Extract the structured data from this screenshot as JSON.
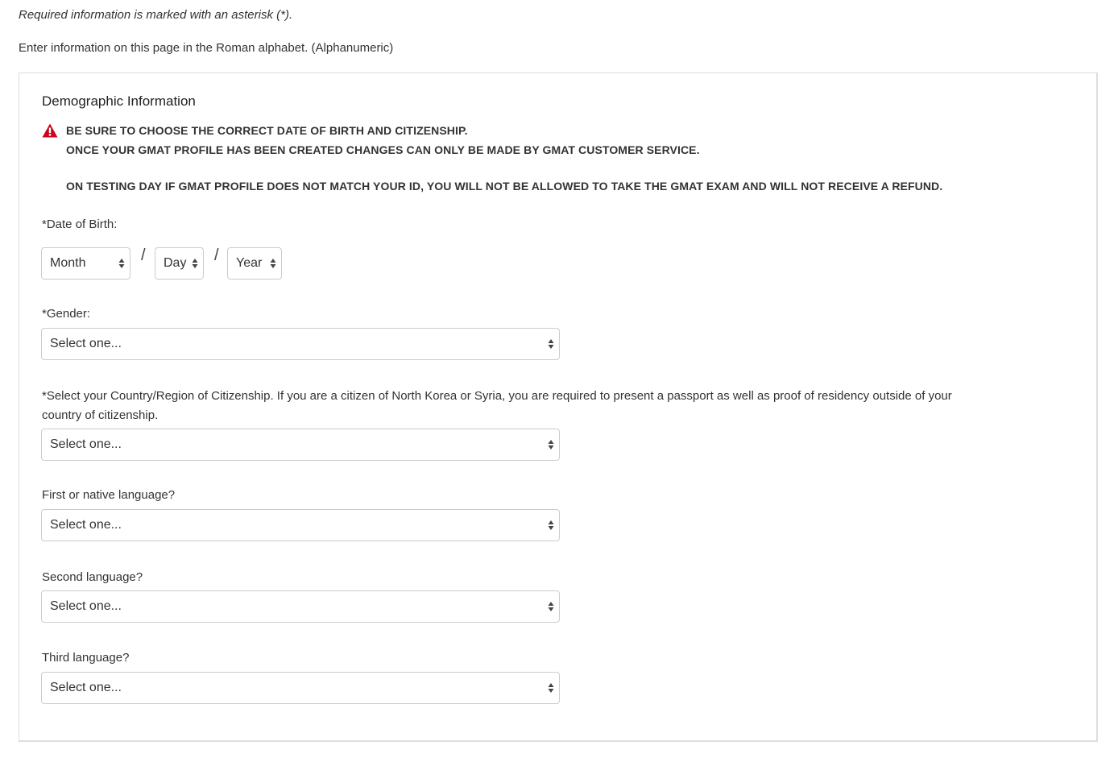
{
  "notes": {
    "required": "Required information is marked with an asterisk (*).",
    "alphabet": "Enter information on this page in the Roman alphabet. (Alphanumeric)"
  },
  "section": {
    "title": "Demographic Information",
    "warning": {
      "icon": "warning-triangle-icon",
      "color": "#d0021b",
      "line1": "BE SURE TO CHOOSE THE CORRECT DATE OF BIRTH AND CITIZENSHIP.",
      "line2": "ONCE YOUR GMAT PROFILE HAS BEEN CREATED CHANGES CAN ONLY BE MADE BY GMAT CUSTOMER SERVICE.",
      "line3": "ON TESTING DAY IF GMAT PROFILE DOES NOT MATCH YOUR ID, YOU WILL NOT BE ALLOWED TO TAKE THE GMAT EXAM AND WILL NOT RECEIVE A REFUND."
    }
  },
  "fields": {
    "dob": {
      "label": "*Date of Birth:",
      "month": "Month",
      "day": "Day",
      "year": "Year",
      "separator": "/"
    },
    "gender": {
      "label": "*Gender:",
      "value": "Select one..."
    },
    "citizenship": {
      "label_line1": "*Select your Country/Region of Citizenship. If you are a citizen of North Korea or Syria, you are required to present a passport as well as proof of residency outside of your",
      "label_line2": "country of citizenship.",
      "value": "Select one..."
    },
    "first_language": {
      "label": "First or native language?",
      "value": "Select one..."
    },
    "second_language": {
      "label": "Second language?",
      "value": "Select one..."
    },
    "third_language": {
      "label": "Third language?",
      "value": "Select one..."
    }
  }
}
